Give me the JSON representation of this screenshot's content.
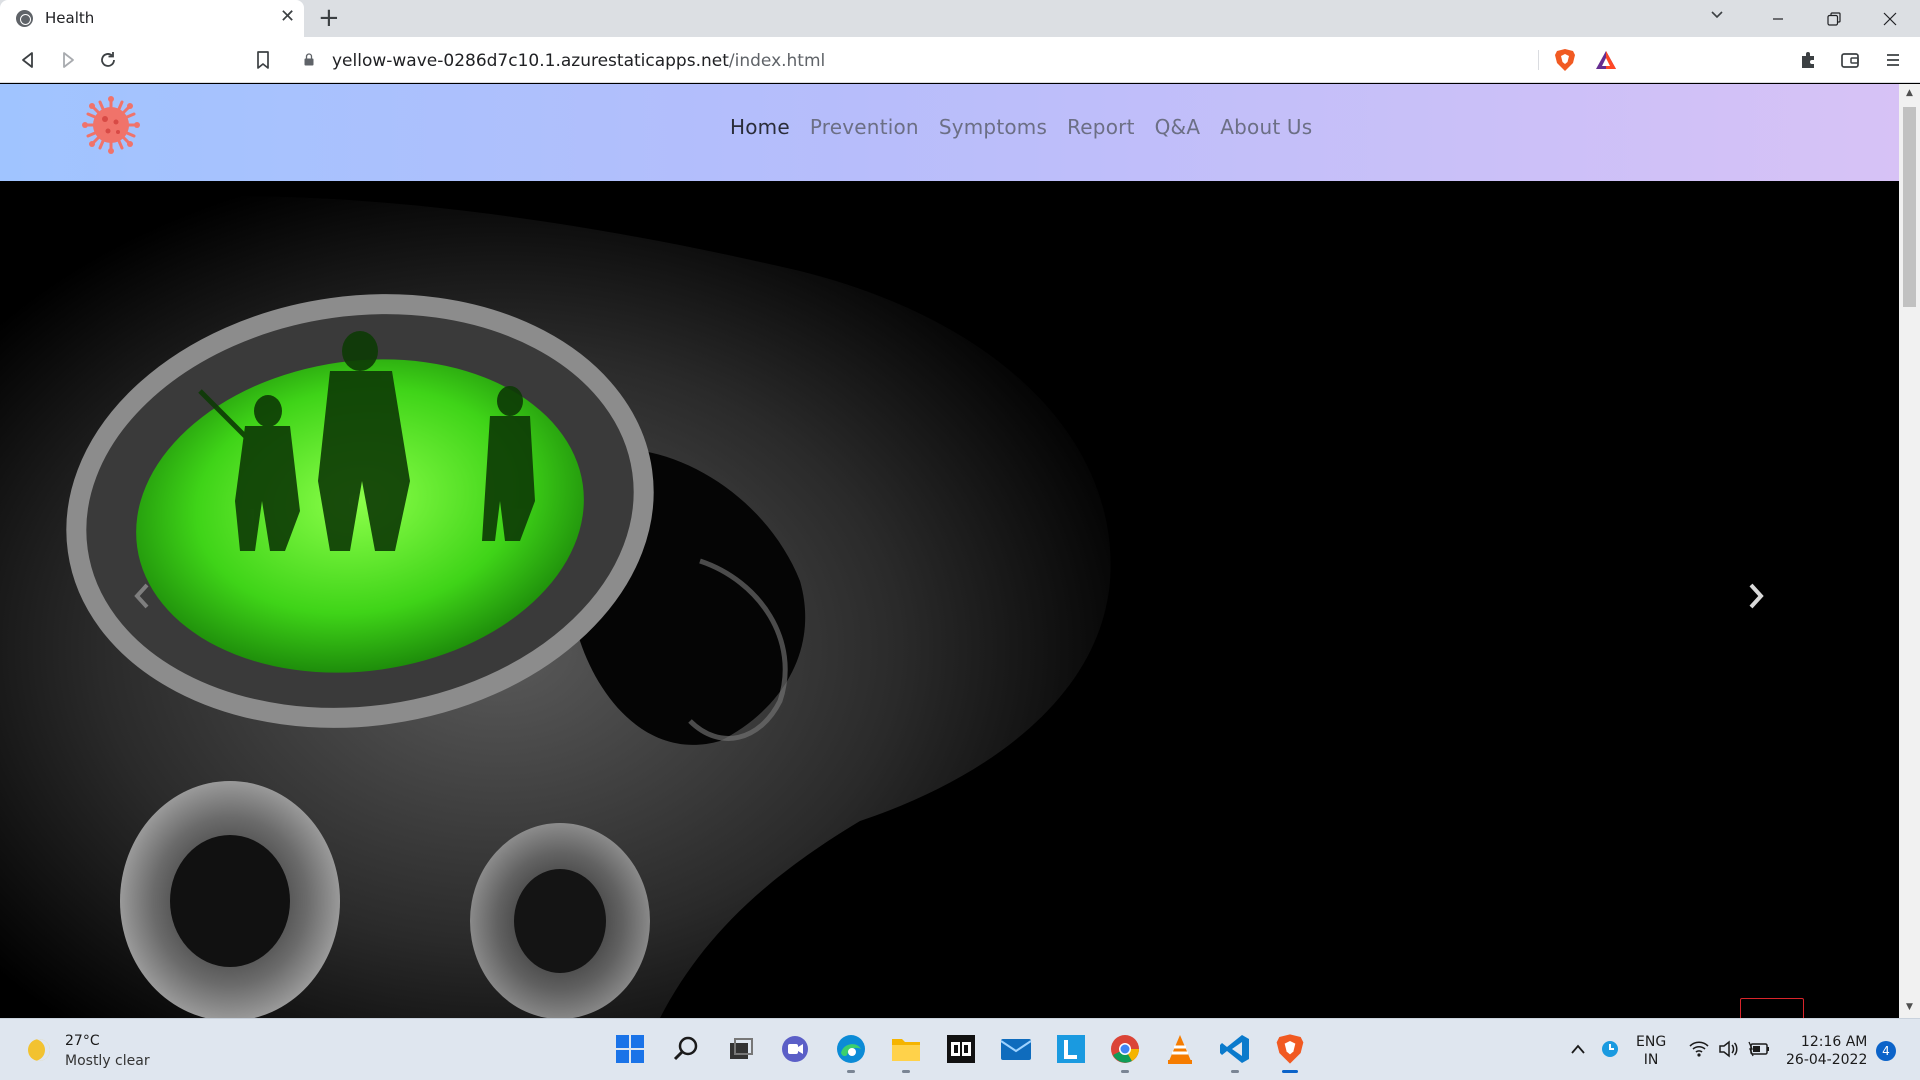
{
  "browser": {
    "tab": {
      "title": "Health"
    },
    "url": {
      "host": "yellow-wave-0286d7c10.1.azurestaticapps.net",
      "path": "/index.html"
    }
  },
  "site": {
    "nav": [
      {
        "label": "Home",
        "active": true
      },
      {
        "label": "Prevention",
        "active": false
      },
      {
        "label": "Symptoms",
        "active": false
      },
      {
        "label": "Report",
        "active": false
      },
      {
        "label": "Q&A",
        "active": false
      },
      {
        "label": "About Us",
        "active": false
      }
    ],
    "colors": {
      "nav_gradient_start": "#a0c4ff",
      "nav_gradient_end": "#d7c2f6",
      "logo": "#f0736a",
      "back_to_top_border": "#d9252b"
    },
    "hero": {
      "image": "gas-mask-skull-night-vision",
      "controls": [
        "carousel-prev-icon",
        "carousel-next-icon"
      ]
    }
  },
  "taskbar": {
    "weather": {
      "temp": "27°C",
      "desc": "Mostly clear"
    },
    "language": {
      "line1": "ENG",
      "line2": "IN"
    },
    "clock": {
      "time": "12:16 AM",
      "date": "26-04-2022"
    },
    "notification_count": "4",
    "apps": [
      "start",
      "search",
      "task-view",
      "teams",
      "edge",
      "file-explorer",
      "dolby",
      "mail",
      "learn",
      "chrome",
      "vlc",
      "vscode",
      "brave"
    ]
  }
}
